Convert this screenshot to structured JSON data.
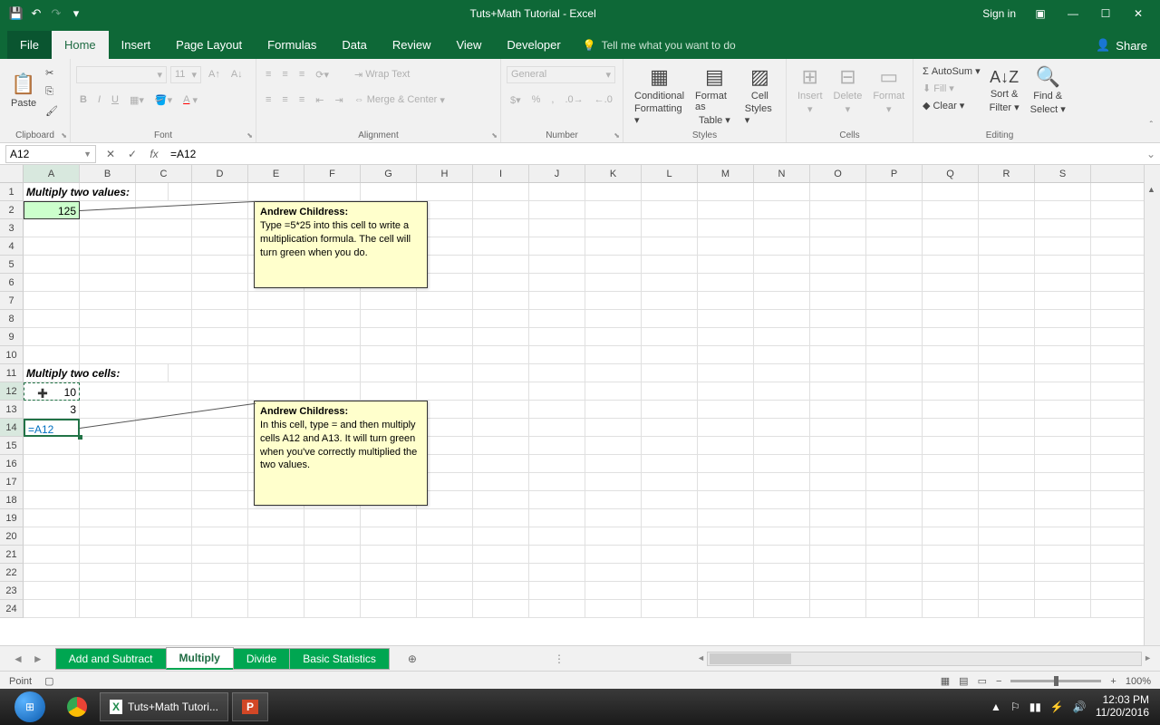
{
  "title": "Tuts+Math Tutorial - Excel",
  "signin": "Sign in",
  "tabs": {
    "file": "File",
    "home": "Home",
    "insert": "Insert",
    "pagelayout": "Page Layout",
    "formulas": "Formulas",
    "data": "Data",
    "review": "Review",
    "view": "View",
    "developer": "Developer",
    "tellme": "Tell me what you want to do",
    "share": "Share"
  },
  "ribbon": {
    "clipboard": {
      "paste": "Paste",
      "label": "Clipboard"
    },
    "font": {
      "size": "11",
      "label": "Font",
      "bold": "B",
      "italic": "I",
      "underline": "U"
    },
    "alignment": {
      "wrap": "Wrap Text",
      "merge": "Merge & Center",
      "label": "Alignment"
    },
    "number": {
      "format": "General",
      "label": "Number"
    },
    "styles": {
      "cf": "Conditional",
      "cf2": "Formatting",
      "fat": "Format as",
      "fat2": "Table",
      "cs": "Cell",
      "cs2": "Styles",
      "label": "Styles"
    },
    "cells": {
      "insert": "Insert",
      "delete": "Delete",
      "format": "Format",
      "label": "Cells"
    },
    "editing": {
      "autosum": "AutoSum",
      "fill": "Fill",
      "clear": "Clear",
      "sort": "Sort &",
      "sort2": "Filter",
      "find": "Find &",
      "find2": "Select",
      "label": "Editing"
    }
  },
  "namebox": "A12",
  "formula": "=A12",
  "columns": [
    "A",
    "B",
    "C",
    "D",
    "E",
    "F",
    "G",
    "H",
    "I",
    "J",
    "K",
    "L",
    "M",
    "N",
    "O",
    "P",
    "Q",
    "R",
    "S"
  ],
  "rows": [
    "1",
    "2",
    "3",
    "4",
    "5",
    "6",
    "7",
    "8",
    "9",
    "10",
    "11",
    "12",
    "13",
    "14",
    "15",
    "16",
    "17",
    "18",
    "19",
    "20",
    "21",
    "22",
    "23",
    "24"
  ],
  "cells": {
    "A1": "Multiply two values:",
    "A2": "125",
    "A11": "Multiply two cells:",
    "A12": "10",
    "A13": "3",
    "A14": "=A12"
  },
  "comment1": {
    "author": "Andrew Childress:",
    "text": "Type =5*25 into this cell to write a multiplication formula. The cell will turn green when you do."
  },
  "comment2": {
    "author": "Andrew Childress:",
    "text": "In this cell, type = and then multiply cells A12 and A13. It will turn green when you've correctly multiplied the two values."
  },
  "sheets": {
    "s1": "Add and Subtract",
    "s2": "Multiply",
    "s3": "Divide",
    "s4": "Basic Statistics"
  },
  "status": {
    "mode": "Point",
    "zoom": "100%"
  },
  "taskbar": {
    "app1": "Tuts+Math Tutori...",
    "time": "12:03 PM",
    "date": "11/20/2016"
  }
}
